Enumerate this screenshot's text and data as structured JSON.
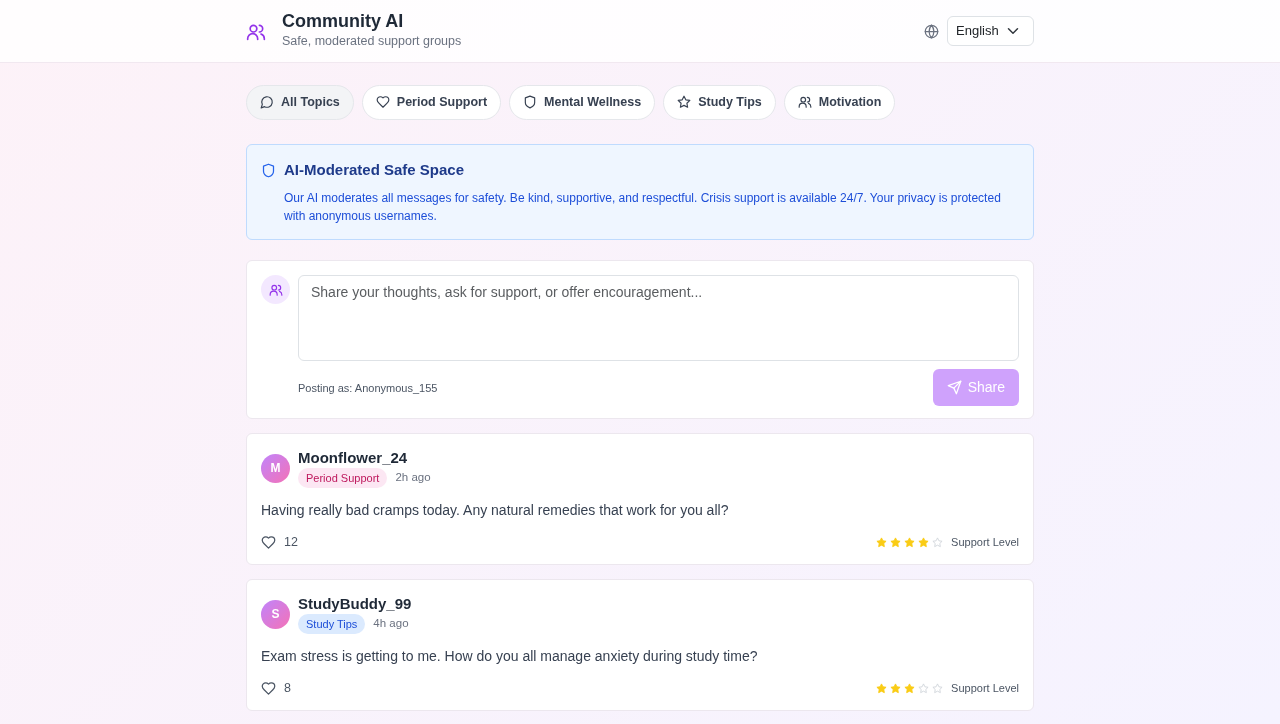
{
  "header": {
    "title": "Community AI",
    "subtitle": "Safe, moderated support groups",
    "language": "English"
  },
  "topics": [
    {
      "label": "All Topics",
      "kind": "chat",
      "selected": true
    },
    {
      "label": "Period Support",
      "kind": "heart",
      "selected": false
    },
    {
      "label": "Mental Wellness",
      "kind": "shield",
      "selected": false
    },
    {
      "label": "Study Tips",
      "kind": "star",
      "selected": false
    },
    {
      "label": "Motivation",
      "kind": "users",
      "selected": false
    }
  ],
  "notice": {
    "title": "AI-Moderated Safe Space",
    "text": "Our AI moderates all messages for safety. Be kind, supportive, and respectful. Crisis support is available 24/7. Your privacy is protected with anonymous usernames."
  },
  "composer": {
    "placeholder": "Share your thoughts, ask for support, or offer encouragement...",
    "posting_as": "Posting as: Anonymous_155",
    "button": "Share",
    "disabled": true
  },
  "posts": [
    {
      "initial": "M",
      "user": "Moonflower_24",
      "tag": "Period Support",
      "color": "#fce7f3",
      "time": "2h ago",
      "text": "Having really bad cramps today. Any natural remedies that work for you all?",
      "likes": "12",
      "stars": 4,
      "rating_label": "Support Level"
    },
    {
      "initial": "S",
      "user": "StudyBuddy_99",
      "tag": "Study Tips",
      "color": "#dbeafe",
      "time": "4h ago",
      "text": "Exam stress is getting to me. How do you all manage anxiety during study time?",
      "likes": "8",
      "stars": 3,
      "rating_label": "Support Level"
    }
  ]
}
